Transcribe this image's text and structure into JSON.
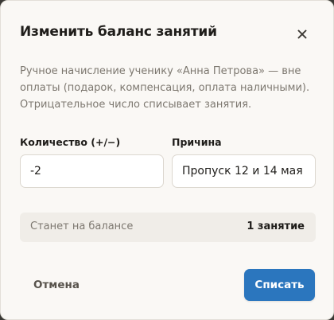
{
  "dialog": {
    "title": "Изменить баланс занятий",
    "close_icon": "close-icon",
    "description": "Ручное начисление ученику «Анна Петрова» — вне оплаты (подарок, компенсация, оплата наличными). Отрицательное число списывает занятия."
  },
  "form": {
    "quantity_label": "Количество (+/−)",
    "quantity_value": "-2",
    "reason_label": "Причина",
    "reason_value": "Пропуск 12 и 14 мая"
  },
  "balance": {
    "label": "Станет на балансе",
    "value": "1 занятие"
  },
  "actions": {
    "cancel_label": "Отмена",
    "submit_label": "Списать"
  },
  "colors": {
    "accent": "#2b76be",
    "background": "#faf8f5",
    "muted_text": "#7d7870"
  }
}
